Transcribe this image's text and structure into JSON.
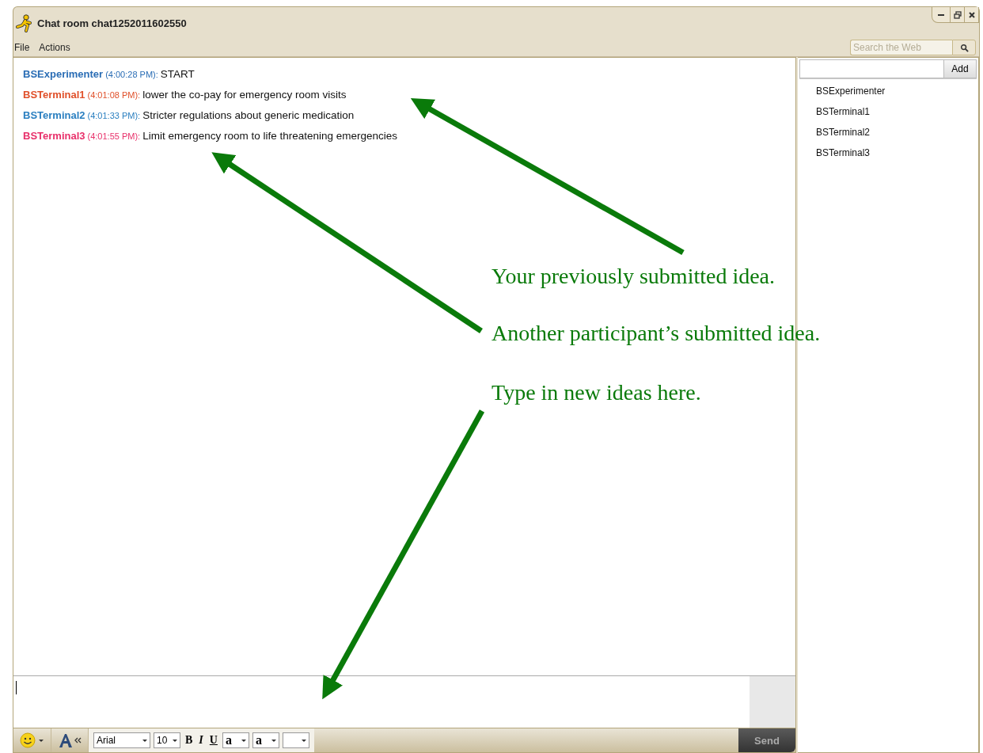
{
  "window": {
    "title": "Chat room chat1252011602550"
  },
  "menu": [
    "File",
    "Actions"
  ],
  "search": {
    "placeholder": "Search the Web"
  },
  "messages": [
    {
      "sender": "BSExperimenter",
      "time": "(4:00:28 PM):",
      "text": "START",
      "color": "#2a6db5"
    },
    {
      "sender": "BSTerminal1",
      "time": "(4:01:08 PM):",
      "text": "lower the co-pay for emergency room visits",
      "color": "#e0502a"
    },
    {
      "sender": "BSTerminal2",
      "time": "(4:01:33 PM):",
      "text": "Stricter regulations about generic medication",
      "color": "#2a7fc0"
    },
    {
      "sender": "BSTerminal3",
      "time": "(4:01:55 PM):",
      "text": "Limit emergency room to life threatening emergencies",
      "color": "#e8306a"
    }
  ],
  "participants": {
    "add_button": "Add",
    "members": [
      "BSExperimenter",
      "BSTerminal1",
      "BSTerminal2",
      "BSTerminal3"
    ]
  },
  "toolbar": {
    "font": "Arial",
    "size": "10",
    "bold": "B",
    "italic": "I",
    "underline": "U",
    "text_color": "a",
    "background_color": "a"
  },
  "send_button": "Send",
  "annotations": [
    {
      "text": "Your previously submitted idea."
    },
    {
      "text": "Another participant’s submitted idea."
    },
    {
      "text": "Type in new ideas here."
    }
  ]
}
